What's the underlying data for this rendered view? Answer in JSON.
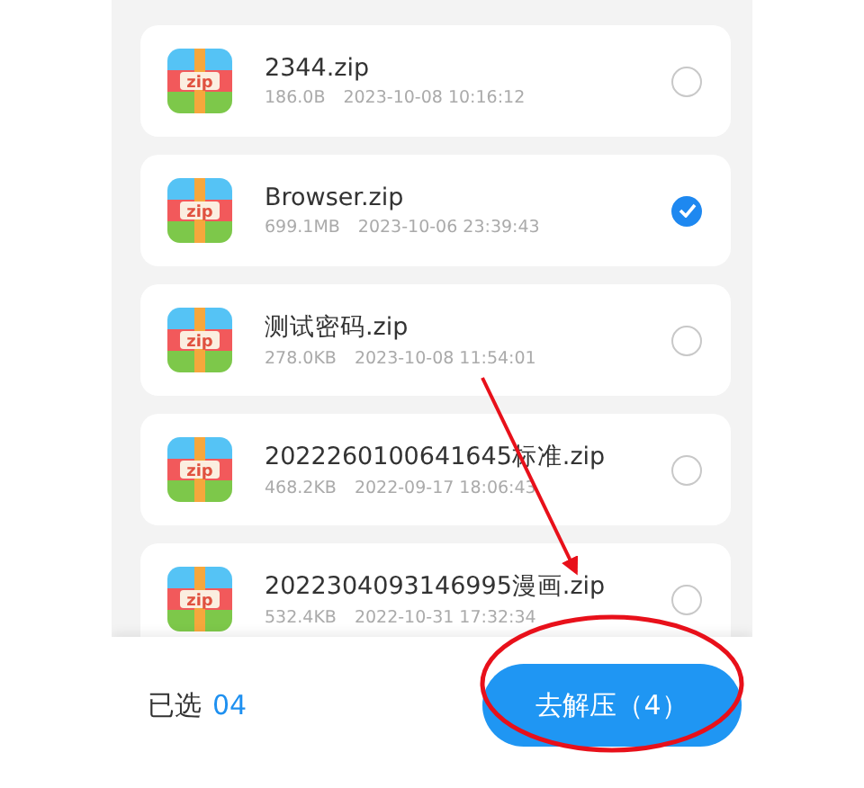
{
  "files": [
    {
      "name": "2344.zip",
      "size": "186.0B",
      "date": "2023-10-08 10:16:12",
      "icon_text": "zip",
      "selected": false
    },
    {
      "name": "Browser.zip",
      "size": "699.1MB",
      "date": "2023-10-06 23:39:43",
      "icon_text": "zip",
      "selected": true
    },
    {
      "name": "测试密码.zip",
      "size": "278.0KB",
      "date": "2023-10-08 11:54:01",
      "icon_text": "zip",
      "selected": false
    },
    {
      "name": "2022260100641645标准.zip",
      "size": "468.2KB",
      "date": "2022-09-17 18:06:43",
      "icon_text": "zip",
      "selected": false
    },
    {
      "name": "2022304093146995漫画.zip",
      "size": "532.4KB",
      "date": "2022-10-31 17:32:34",
      "icon_text": "zip",
      "selected": false
    }
  ],
  "footer": {
    "label": "已选",
    "count": "04",
    "button": "去解压（4）"
  }
}
